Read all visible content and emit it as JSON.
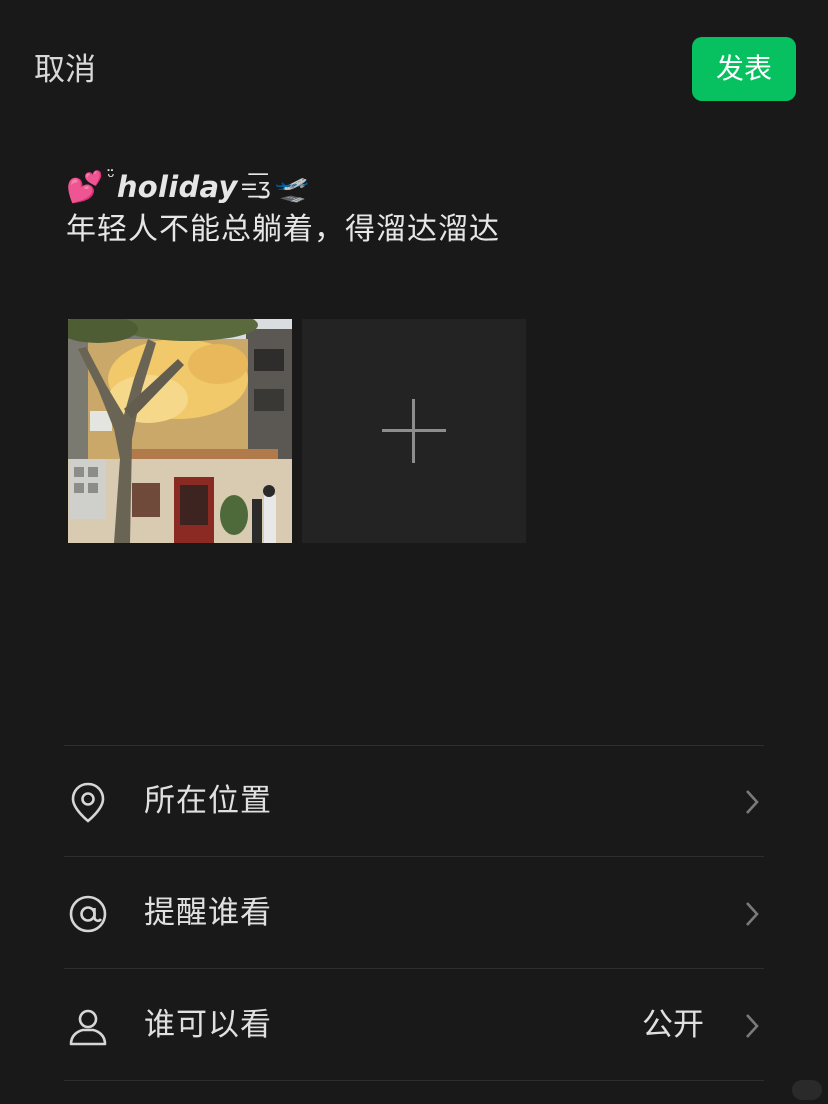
{
  "header": {
    "cancel_label": "取消",
    "publish_label": "发表",
    "publish_color": "#07c160"
  },
  "post": {
    "line1": {
      "emoji_heart": "💕",
      "smile": "ᵕ̈",
      "word": "holiday",
      "kiss": "=͟͟͞ʒ",
      "emoji_plane": "🛫"
    },
    "line2": "年轻人不能总躺着，得溜达溜达"
  },
  "photos": [
    {
      "description_icon": "photo-thumbnail"
    }
  ],
  "add_tile": {
    "icon": "plus-icon"
  },
  "options": [
    {
      "label": "所在位置",
      "icon": "location-pin-icon",
      "value": ""
    },
    {
      "label": "提醒谁看",
      "icon": "at-icon",
      "value": ""
    },
    {
      "label": "谁可以看",
      "icon": "person-icon",
      "value": "公开"
    }
  ]
}
